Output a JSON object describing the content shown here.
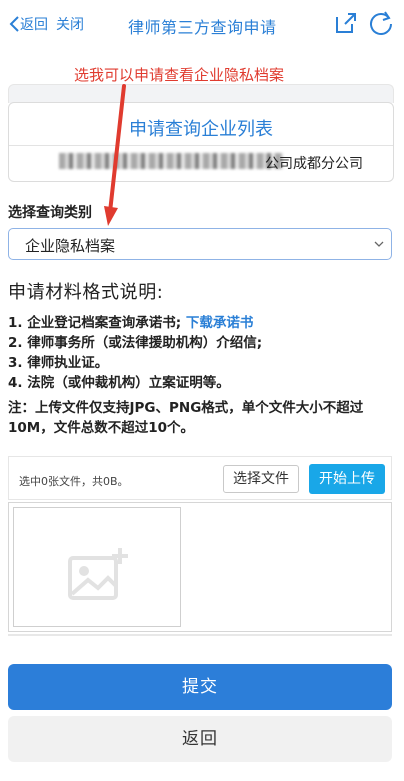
{
  "nav": {
    "back_label": "返回",
    "close_label": "关闭",
    "title": "律师第三方查询申请"
  },
  "annotation": {
    "text": "选我可以申请查看企业隐私档案",
    "color": "#e03b2f"
  },
  "list_card": {
    "title": "申请查询企业列表",
    "company_visible_suffix": "公司成都分公司"
  },
  "category": {
    "label": "选择查询类别",
    "selected": "企业隐私档案"
  },
  "materials": {
    "heading": "申请材料格式说明:",
    "items": [
      "1. 企业登记档案查询承诺书;",
      "2. 律师事务所（或法律援助机构）介绍信;",
      "3. 律师执业证。",
      "4. 法院（或仲裁机构）立案证明等。"
    ],
    "download_link": "下载承诺书",
    "note": "注：上传文件仅支持JPG、PNG格式，单个文件大小不超过10M，文件总数不超过10个。"
  },
  "upload": {
    "status": "选中0张文件，共0B。",
    "choose_label": "选择文件",
    "start_label": "开始上传"
  },
  "actions": {
    "submit_label": "提交",
    "back_label": "返回"
  },
  "colors": {
    "accent": "#2a7fd6",
    "submit_bg": "#2c7ed9",
    "upload_bg": "#19a7e8"
  }
}
